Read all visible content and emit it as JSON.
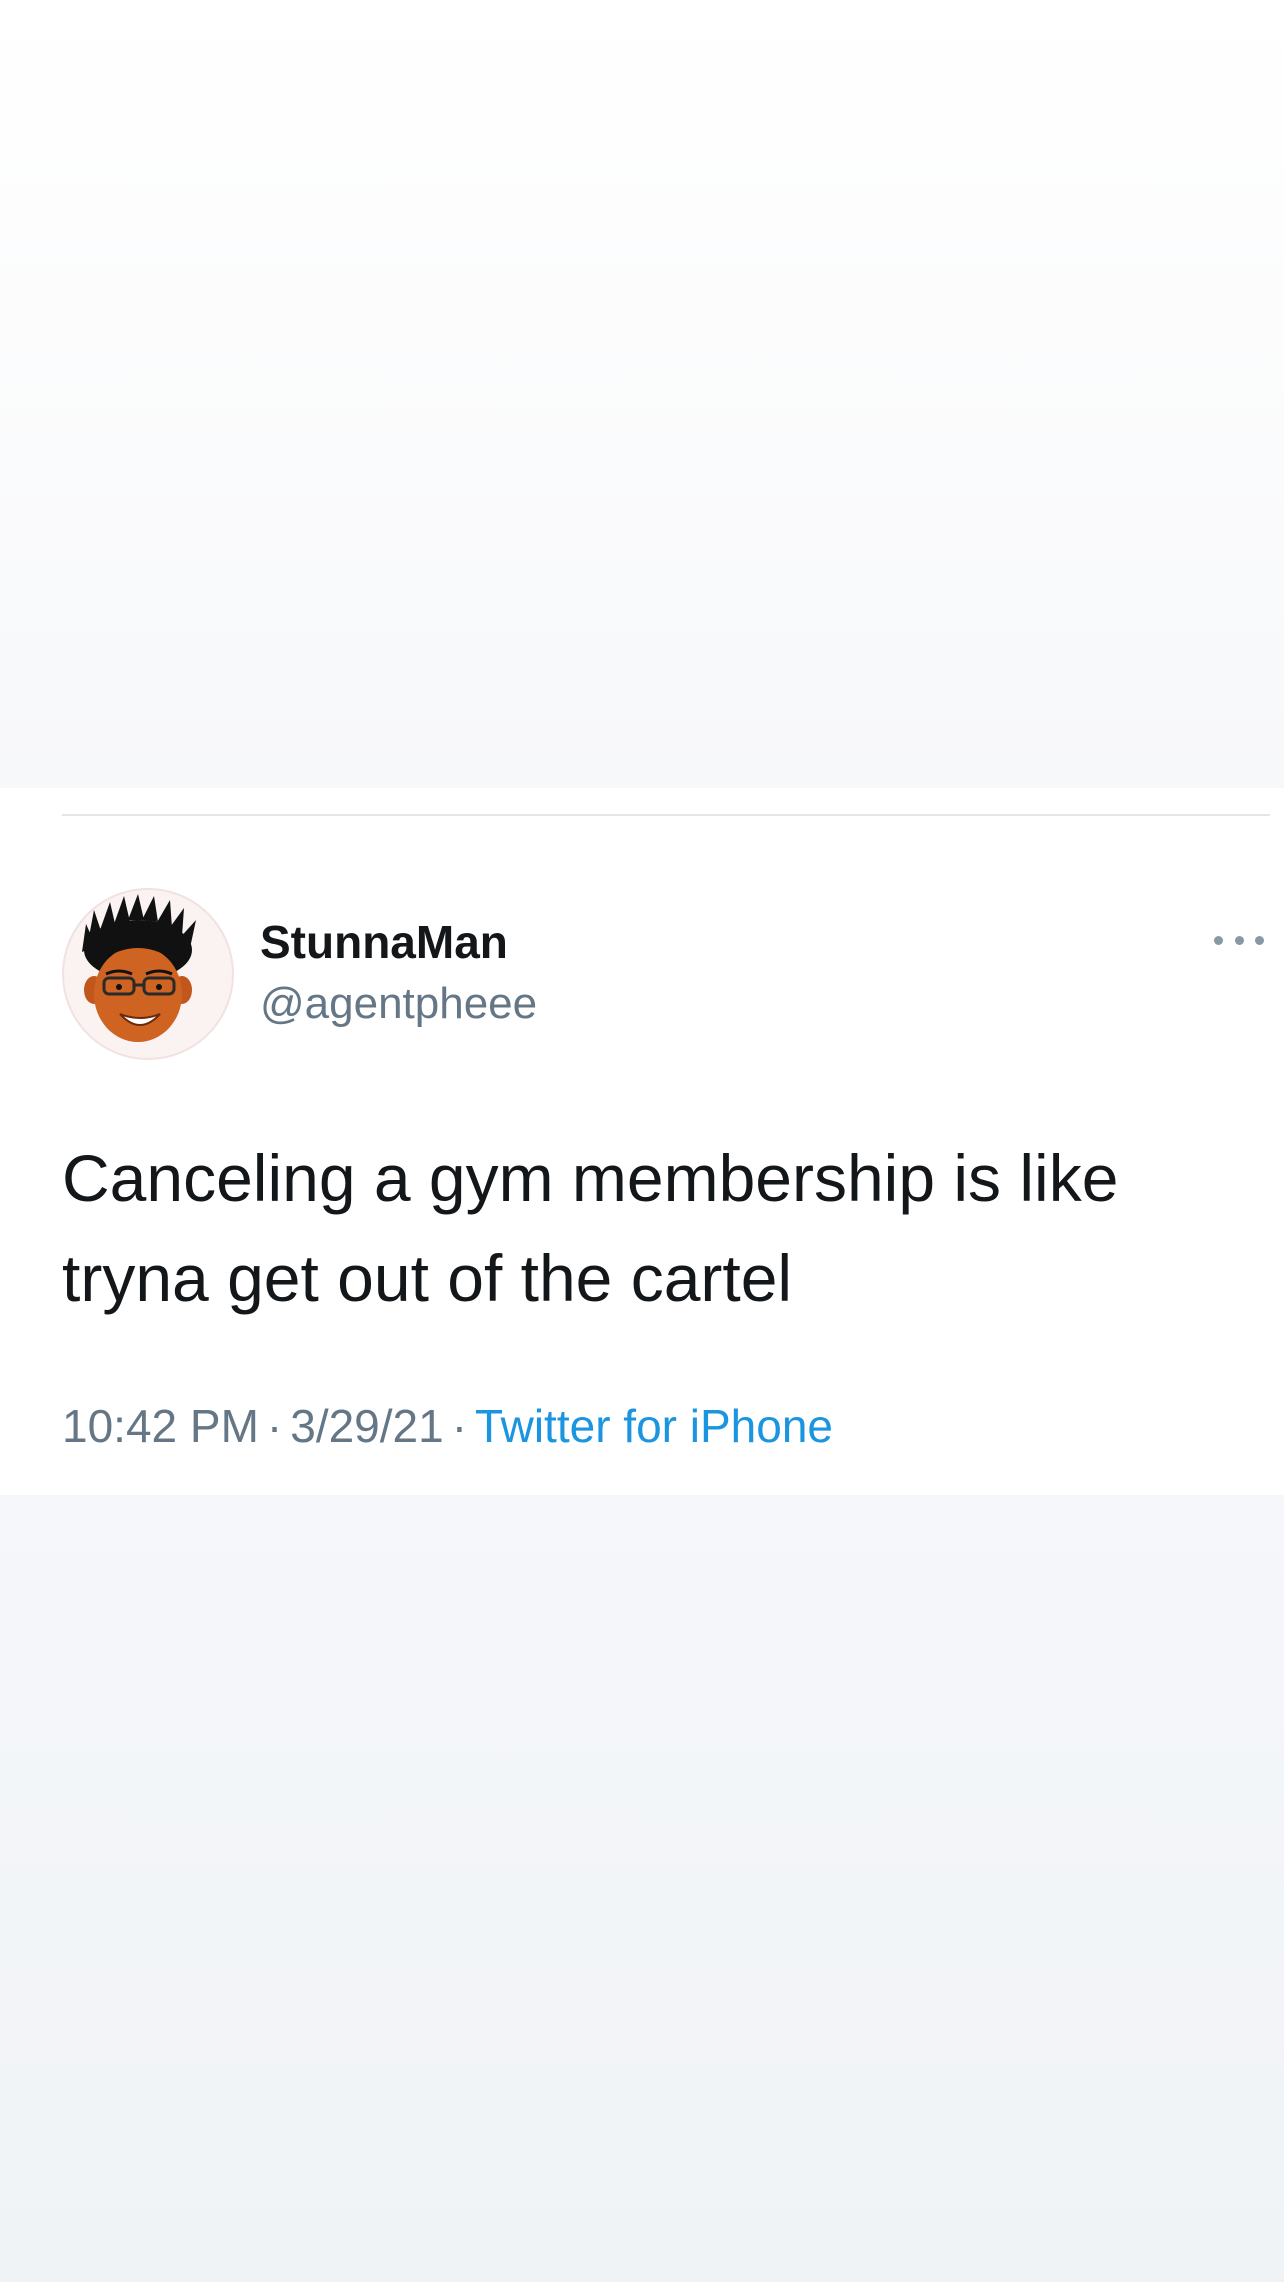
{
  "tweet": {
    "display_name": "StunnaMan",
    "handle": "@agentpheee",
    "text_line_1": "Canceling a gym membership is like",
    "text_line_2": "tryna get out of the cartel",
    "time": "10:42 PM",
    "date": "3/29/21",
    "separator": "·",
    "source": "Twitter for iPhone"
  },
  "icons": {
    "avatar": "cartoon-avatar",
    "more": "more-options-icon"
  },
  "colors": {
    "text_primary": "#14171a",
    "text_secondary": "#657786",
    "link": "#1b95e0"
  }
}
